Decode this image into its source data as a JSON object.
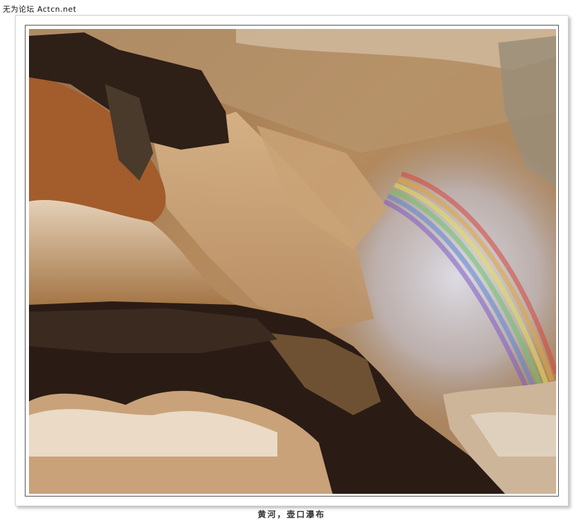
{
  "header": {
    "watermark": "无为论坛 Actcn.net"
  },
  "photo": {
    "subject": "waterfall-with-rainbow",
    "colors": {
      "water": "#b9895a",
      "rock": "#2b1d14",
      "mist": "#c9c6cf"
    }
  },
  "footer": {
    "caption": "黄河，壶口瀑布"
  }
}
